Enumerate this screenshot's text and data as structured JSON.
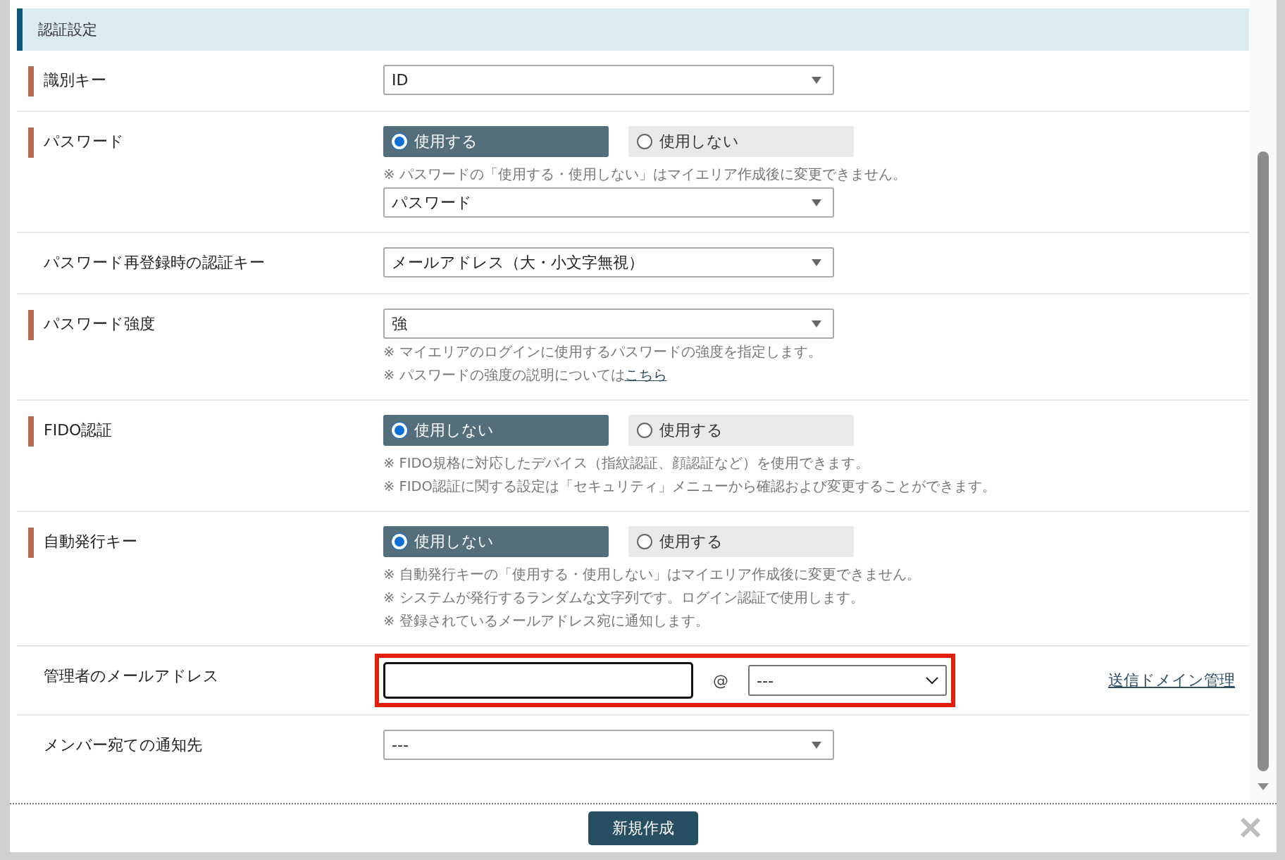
{
  "section": {
    "title": "認証設定"
  },
  "rows": [
    {
      "label": "識別キー",
      "required": true,
      "controls": [
        {
          "kind": "select",
          "value": "ID"
        }
      ]
    },
    {
      "label": "パスワード",
      "required": true,
      "controls": [
        {
          "kind": "radio",
          "options": [
            {
              "label": "使用する",
              "selected": true
            },
            {
              "label": "使用しない",
              "selected": false
            }
          ]
        },
        {
          "kind": "note",
          "text": "※ パスワードの「使用する・使用しない」はマイエリア作成後に変更できません。"
        },
        {
          "kind": "select",
          "value": "パスワード"
        }
      ]
    },
    {
      "label": "パスワード再登録時の認証キー",
      "required": false,
      "controls": [
        {
          "kind": "select",
          "value": "メールアドレス（大・小文字無視）"
        }
      ]
    },
    {
      "label": "パスワード強度",
      "required": true,
      "controls": [
        {
          "kind": "select",
          "value": "強"
        },
        {
          "kind": "note",
          "text": "※ マイエリアのログインに使用するパスワードの強度を指定します。"
        },
        {
          "kind": "note",
          "text": "※ パスワードの強度の説明については",
          "link": "こちら"
        }
      ]
    },
    {
      "label": "FIDO認証",
      "required": true,
      "controls": [
        {
          "kind": "radio",
          "options": [
            {
              "label": "使用しない",
              "selected": true
            },
            {
              "label": "使用する",
              "selected": false
            }
          ]
        },
        {
          "kind": "note",
          "text": "※ FIDO規格に対応したデバイス（指紋認証、顔認証など）を使用できます。"
        },
        {
          "kind": "note",
          "text": "※ FIDO認証に関する設定は「セキュリティ」メニューから確認および変更することができます。"
        }
      ]
    },
    {
      "label": "自動発行キー",
      "required": true,
      "controls": [
        {
          "kind": "radio",
          "options": [
            {
              "label": "使用しない",
              "selected": true
            },
            {
              "label": "使用する",
              "selected": false
            }
          ]
        },
        {
          "kind": "note",
          "text": "※ 自動発行キーの「使用する・使用しない」はマイエリア作成後に変更できません。"
        },
        {
          "kind": "note",
          "text": "※ システムが発行するランダムな文字列です。ログイン認証で使用します。"
        },
        {
          "kind": "note",
          "text": "※ 登録されているメールアドレス宛に通知します。"
        }
      ]
    },
    {
      "label": "管理者のメールアドレス",
      "required": false,
      "controls": [
        {
          "kind": "email",
          "at": "@",
          "domain": "---",
          "highlighted": true,
          "link": "送信ドメイン管理"
        }
      ]
    },
    {
      "label": "メンバー宛ての通知先",
      "required": false,
      "controls": [
        {
          "kind": "select",
          "value": "---"
        }
      ]
    }
  ],
  "footer": {
    "button": "新規作成"
  }
}
